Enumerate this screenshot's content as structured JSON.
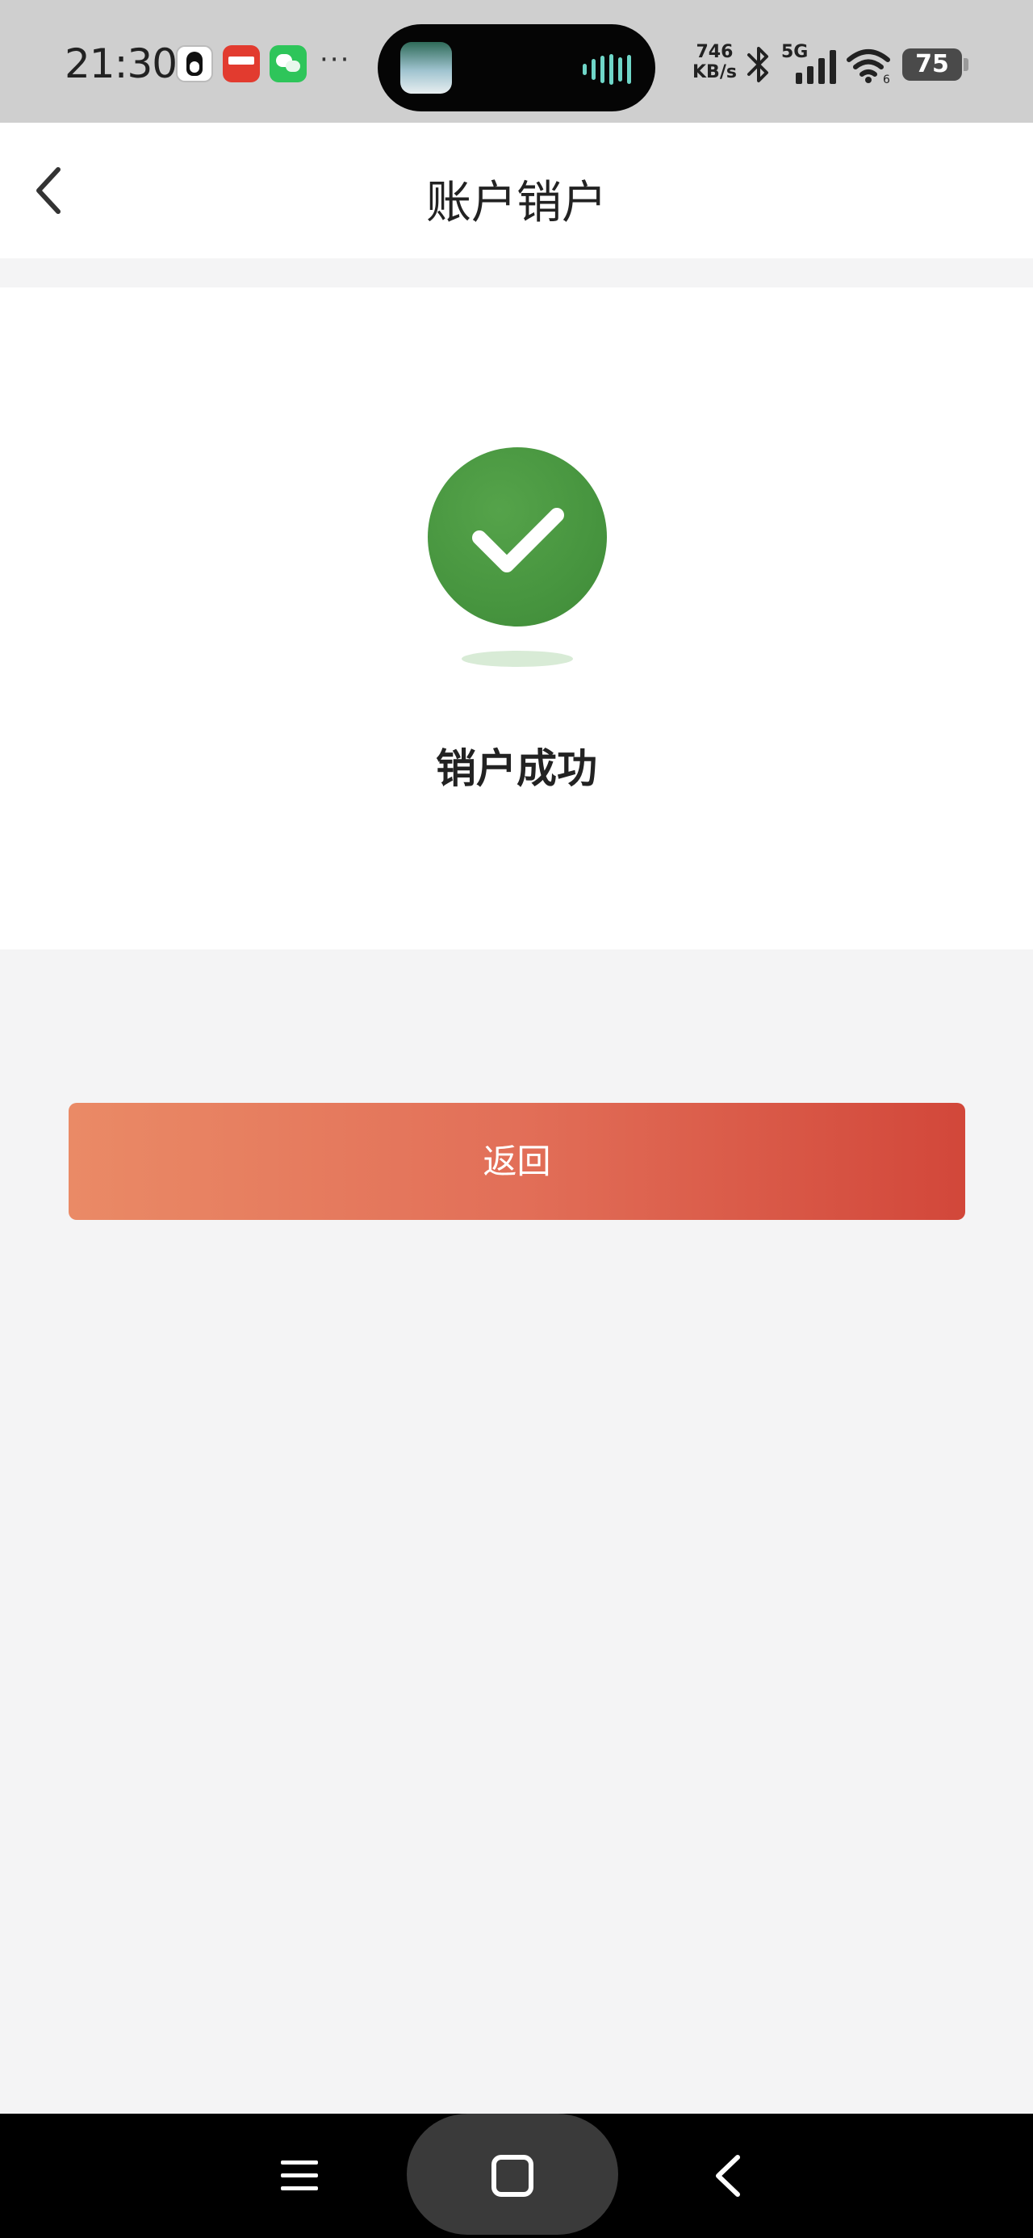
{
  "status_bar": {
    "time": "21:30",
    "more": "···",
    "net_speed_value": "746",
    "net_speed_unit": "KB/s",
    "network_type": "5G",
    "wifi_label": "6",
    "battery": "75",
    "notification_icons": [
      "qq-icon",
      "red-app-icon",
      "wechat-icon"
    ]
  },
  "header": {
    "title": "账户销户",
    "back_icon": "chevron-left-icon"
  },
  "result": {
    "icon": "check-circle-icon",
    "status_color": "#47953f",
    "message": "销户成功"
  },
  "actions": {
    "return_label": "返回",
    "button_gradient": [
      "#ea8a66",
      "#d2473a"
    ]
  },
  "nav_bar": {
    "icons": [
      "menu-icon",
      "home-icon",
      "back-icon"
    ]
  }
}
